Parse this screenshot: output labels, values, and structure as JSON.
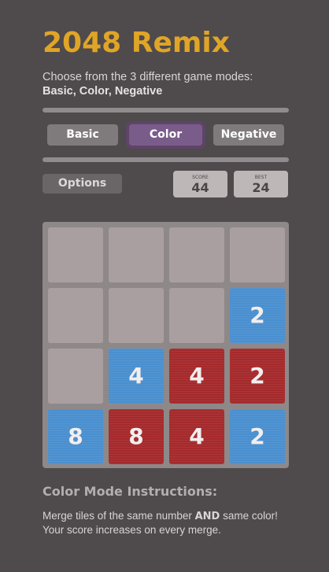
{
  "title": "2048 Remix",
  "intro": {
    "line1": "Choose from the 3 different game modes:",
    "modes_line": "Basic, Color, Negative"
  },
  "modes": {
    "basic_label": "Basic",
    "color_label": "Color",
    "negative_label": "Negative",
    "active": "Color"
  },
  "options_label": "Options",
  "score": {
    "label": "SCORE",
    "value": "44"
  },
  "best": {
    "label": "BEST",
    "value": "24"
  },
  "board": {
    "size": 4,
    "tiles": [
      {
        "row": 1,
        "col": 3,
        "value": "2",
        "color": "blue"
      },
      {
        "row": 2,
        "col": 1,
        "value": "4",
        "color": "blue"
      },
      {
        "row": 2,
        "col": 2,
        "value": "4",
        "color": "red"
      },
      {
        "row": 2,
        "col": 3,
        "value": "2",
        "color": "red"
      },
      {
        "row": 3,
        "col": 0,
        "value": "8",
        "color": "blue"
      },
      {
        "row": 3,
        "col": 1,
        "value": "8",
        "color": "red"
      },
      {
        "row": 3,
        "col": 2,
        "value": "4",
        "color": "red"
      },
      {
        "row": 3,
        "col": 3,
        "value": "2",
        "color": "blue"
      }
    ]
  },
  "instructions": {
    "title": "Color Mode Instructions:",
    "line1_start": "Merge tiles of the same number",
    "line1_bold": "AND",
    "line1_end": "same color!",
    "line2": "Your score increases on every merge."
  },
  "colors": {
    "background": "#4f4a4c",
    "title": "#e0a526",
    "tile_blue": "#4a8fcf",
    "tile_red": "#a52a2c",
    "active_mode": "#7a5c8a"
  }
}
